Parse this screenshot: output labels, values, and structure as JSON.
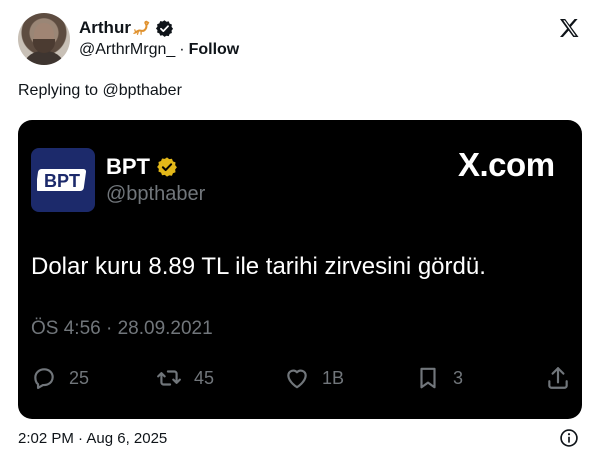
{
  "author": {
    "name": "Arthur",
    "name_emoji": "scorpion-emoji",
    "handle": "@ArthrMrgn_",
    "separator": "·",
    "follow_label": "Follow",
    "verified": true
  },
  "reply_line": "Replying to @bpthaber",
  "embedded_tweet": {
    "account_name": "BPT",
    "account_handle": "@bpthaber",
    "logo_text": "BPT",
    "brand": "X.com",
    "text": "Dolar kuru 8.89 TL ile tarihi zirvesini gördü.",
    "timestamp": "ÖS 4:56 · 28.09.2021",
    "actions": {
      "replies": "25",
      "retweets": "45",
      "likes": "1B",
      "bookmarks": "3"
    }
  },
  "footer": {
    "timestamp": "2:02 PM · Aug 6, 2025"
  },
  "colors": {
    "verified_blue": "#1d9bf0",
    "verified_gold": "#e2b719",
    "card_bg": "#000000",
    "muted": "#71767b"
  }
}
